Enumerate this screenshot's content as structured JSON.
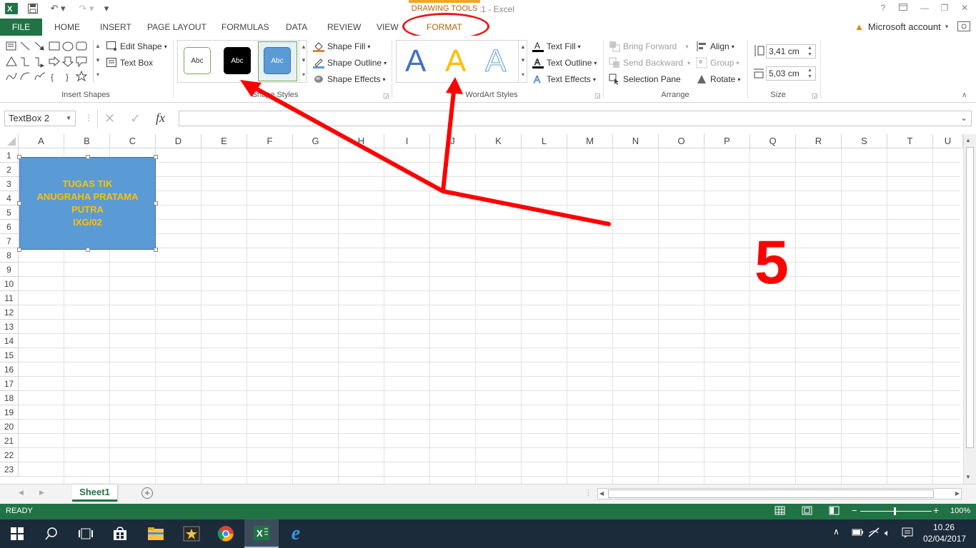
{
  "window": {
    "title": "Book1 - Excel",
    "context_header": "DRAWING TOOLS",
    "help": "?",
    "account": "Microsoft account"
  },
  "tabs": [
    "FILE",
    "HOME",
    "INSERT",
    "PAGE LAYOUT",
    "FORMULAS",
    "DATA",
    "REVIEW",
    "VIEW",
    "FORMAT"
  ],
  "ribbon": {
    "insert_shapes": {
      "label": "Insert Shapes",
      "edit_shape": "Edit Shape",
      "text_box": "Text Box"
    },
    "shape_styles": {
      "label": "Shape Styles",
      "thumb_text": "Abc",
      "shape_fill": "Shape Fill",
      "shape_outline": "Shape Outline",
      "shape_effects": "Shape Effects"
    },
    "wordart_styles": {
      "label": "WordArt Styles",
      "letter": "A",
      "text_fill": "Text Fill",
      "text_outline": "Text Outline",
      "text_effects": "Text Effects"
    },
    "arrange": {
      "label": "Arrange",
      "bring_forward": "Bring Forward",
      "send_backward": "Send Backward",
      "selection_pane": "Selection Pane",
      "align": "Align",
      "group": "Group",
      "rotate": "Rotate"
    },
    "size": {
      "label": "Size",
      "height": "3,41 cm",
      "width": "5,03 cm"
    }
  },
  "formula_bar": {
    "name_box": "TextBox 2",
    "fx": "fx"
  },
  "grid": {
    "columns": [
      "A",
      "B",
      "C",
      "D",
      "E",
      "F",
      "G",
      "H",
      "I",
      "J",
      "K",
      "L",
      "M",
      "N",
      "O",
      "P",
      "Q",
      "R",
      "S",
      "T",
      "U"
    ],
    "rows": [
      "1",
      "2",
      "3",
      "4",
      "5",
      "6",
      "7",
      "8",
      "9",
      "10",
      "11",
      "12",
      "13",
      "14",
      "15",
      "16",
      "17",
      "18",
      "19",
      "20",
      "21",
      "22",
      "23"
    ]
  },
  "textbox": {
    "line1": "TUGAS TIK",
    "line2": "ANUGRAHA PRATAMA",
    "line3": "PUTRA",
    "line4": "IXG/02"
  },
  "annotation": {
    "step_number": "5",
    "color": "#ff0000"
  },
  "sheets": [
    "Sheet1"
  ],
  "status": {
    "ready": "READY",
    "zoom": "100%"
  },
  "taskbar": {
    "time": "10.26",
    "date": "02/04/2017"
  },
  "colors": {
    "excel_green": "#217346",
    "format_tab": "#b8620f",
    "shape_fill": "#5b9bd5",
    "shape_text": "#ffc000"
  }
}
